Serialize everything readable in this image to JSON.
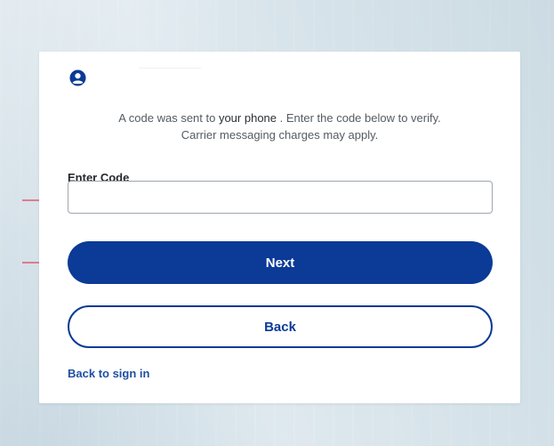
{
  "card": {
    "message_prefix": "A code was sent to ",
    "message_highlight": "your phone",
    "message_suffix": " .  Enter the code below to verify.",
    "message_line2": "Carrier messaging charges may apply.",
    "field_label": "Enter Code",
    "code_value": "",
    "next_label": "Next",
    "back_label": "Back",
    "back_to_signin_label": "Back to sign in"
  },
  "icons": {
    "user": "user-circle-icon",
    "annotation_arrow": "arrow-right-icon"
  },
  "colors": {
    "primary": "#0b3a97",
    "link": "#1d4fa3",
    "annotation": "#e05a6e"
  }
}
